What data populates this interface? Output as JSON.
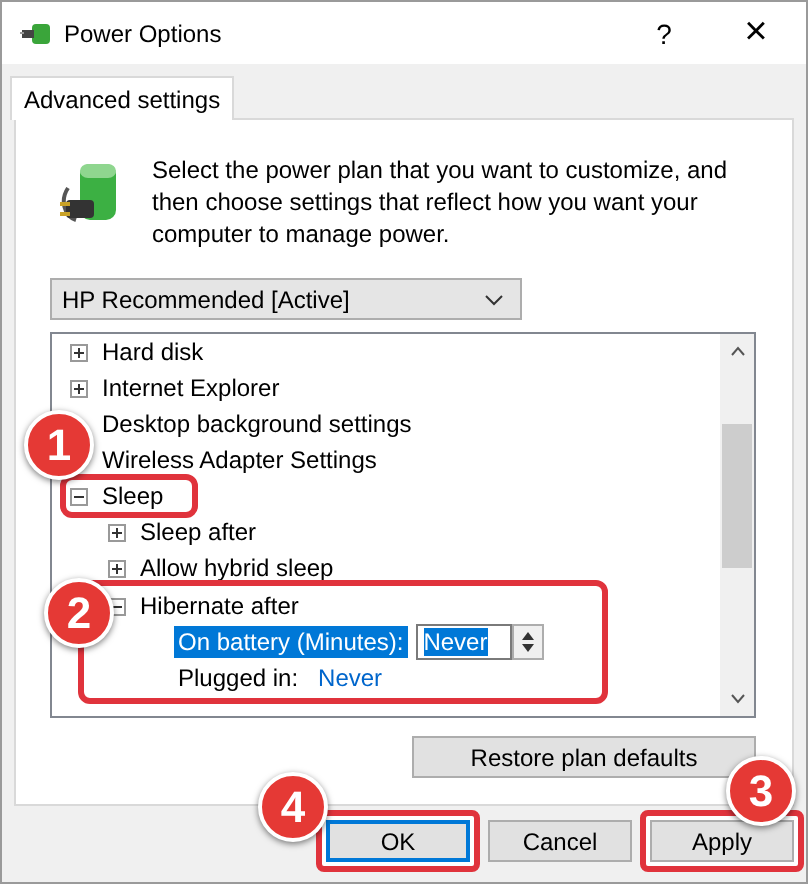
{
  "window": {
    "title": "Power Options",
    "help_button": "?",
    "close_button": "×"
  },
  "tabs": [
    {
      "label": "Advanced settings",
      "selected": true
    }
  ],
  "description": "Select the power plan that you want to customize, and then choose settings that reflect how you want your computer to manage power.",
  "plan_select": {
    "value": "HP Recommended [Active]"
  },
  "tree": [
    {
      "label": "Hard disk",
      "expanded": false
    },
    {
      "label": "Internet Explorer",
      "expanded": false
    },
    {
      "label": "Desktop background settings"
    },
    {
      "label": "Wireless Adapter Settings"
    },
    {
      "label": "Sleep",
      "expanded": true,
      "highlighted": true,
      "children": [
        {
          "label": "Sleep after",
          "expanded": false
        },
        {
          "label": "Allow hybrid sleep",
          "expanded": false
        },
        {
          "label": "Hibernate after",
          "expanded": true,
          "highlighted": true,
          "children": [
            {
              "kind": "spin",
              "label": "On battery (Minutes):",
              "value": "Never",
              "selected": true,
              "highlighted": true
            },
            {
              "kind": "link",
              "label": "Plugged in:",
              "value": "Never",
              "selected": false,
              "highlighted": true
            }
          ]
        }
      ]
    }
  ],
  "restore_button": "Restore plan defaults",
  "buttons": [
    {
      "label": "OK",
      "default": true,
      "highlighted": true
    },
    {
      "label": "Cancel",
      "default": false,
      "highlighted": false
    },
    {
      "label": "Apply",
      "default": false,
      "highlighted": true
    }
  ],
  "callouts": [
    {
      "label": "1"
    },
    {
      "label": "2"
    },
    {
      "label": "3"
    },
    {
      "label": "4"
    }
  ]
}
